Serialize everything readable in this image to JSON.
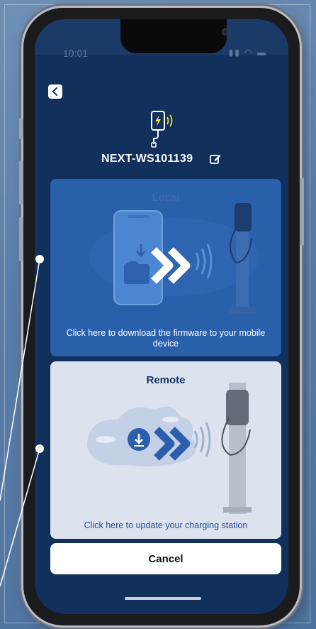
{
  "status_bar": {
    "time": "10:01",
    "icons": [
      "signal-icon",
      "wifi-icon",
      "battery-icon"
    ]
  },
  "header": {
    "back_icon": "chevron-left-icon",
    "device_icon": "charging-station-icon",
    "device_name": "NEXT-WS101139",
    "edit_icon": "edit-icon"
  },
  "options": {
    "local": {
      "title": "Local",
      "caption": "Click here to download the firmware to your mobile device"
    },
    "remote": {
      "title": "Remote",
      "caption": "Click here to update your charging station"
    }
  },
  "cancel_label": "Cancel",
  "colors": {
    "screen_bg": "#11305c",
    "local_card": "#2a5faa",
    "remote_card": "#dde3ee",
    "accent_blue": "#1f4f9c",
    "lightning_yellow": "#f2e23a"
  }
}
